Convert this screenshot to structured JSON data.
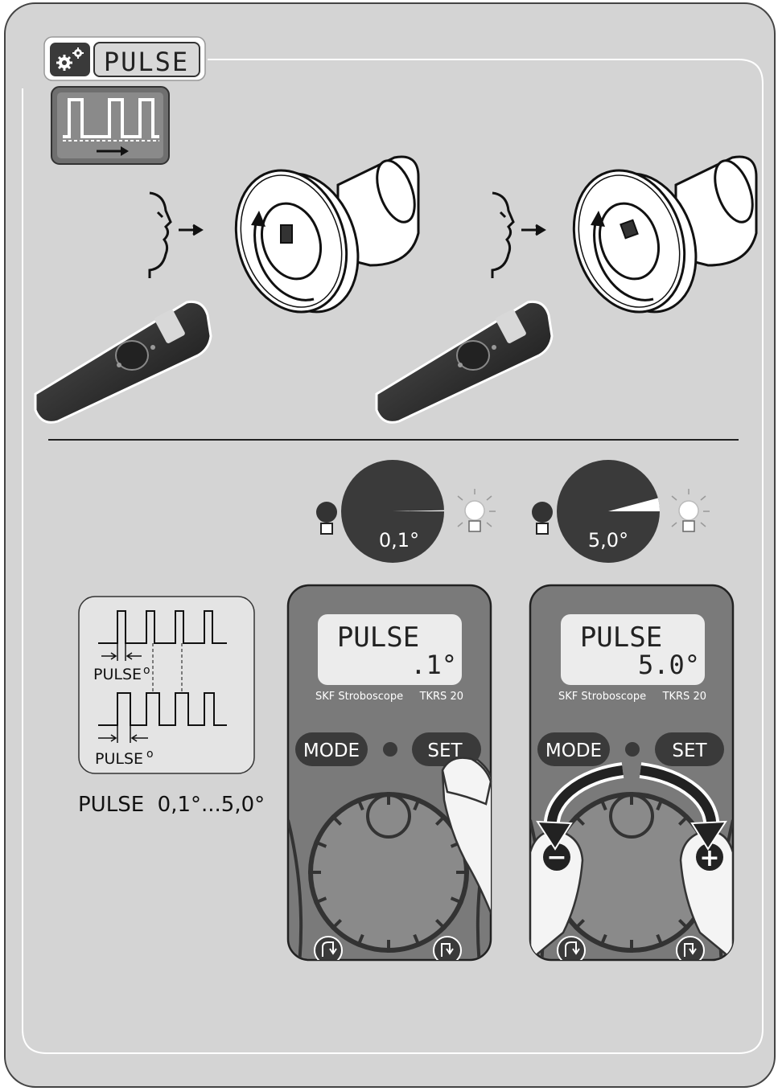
{
  "header": {
    "mode_title": "PULSE",
    "gear_icon": "gear-icon",
    "pulse_wave_icon": "pulse-waveform-icon"
  },
  "pulse_diagram": {
    "top_label": "PULSE",
    "bottom_label": "PULSE",
    "range_text": "PULSE  0,1°...5,0°"
  },
  "angles": [
    {
      "text": "0,1°",
      "value": 0.1
    },
    {
      "text": "5,0°",
      "value": 5.0
    }
  ],
  "devices": [
    {
      "lcd_line1": "PULSE",
      "lcd_line2": ".1°",
      "brand": "SKF Stroboscope",
      "model": "TKRS 20",
      "mode_button": "MODE",
      "set_button": "SET",
      "action": "press-set"
    },
    {
      "lcd_line1": "PULSE",
      "lcd_line2": "5.0°",
      "brand": "SKF Stroboscope",
      "model": "TKRS 20",
      "mode_button": "MODE",
      "set_button": "SET",
      "action": "rotate-dial",
      "minus_symbol": "−",
      "plus_symbol": "+"
    }
  ],
  "colors": {
    "frame_bg": "#d4d4d4",
    "panel_dark": "#7a7a7a",
    "button_dark": "#3a3a3a",
    "lcd_bg": "#ececec",
    "outline": "#222222"
  }
}
